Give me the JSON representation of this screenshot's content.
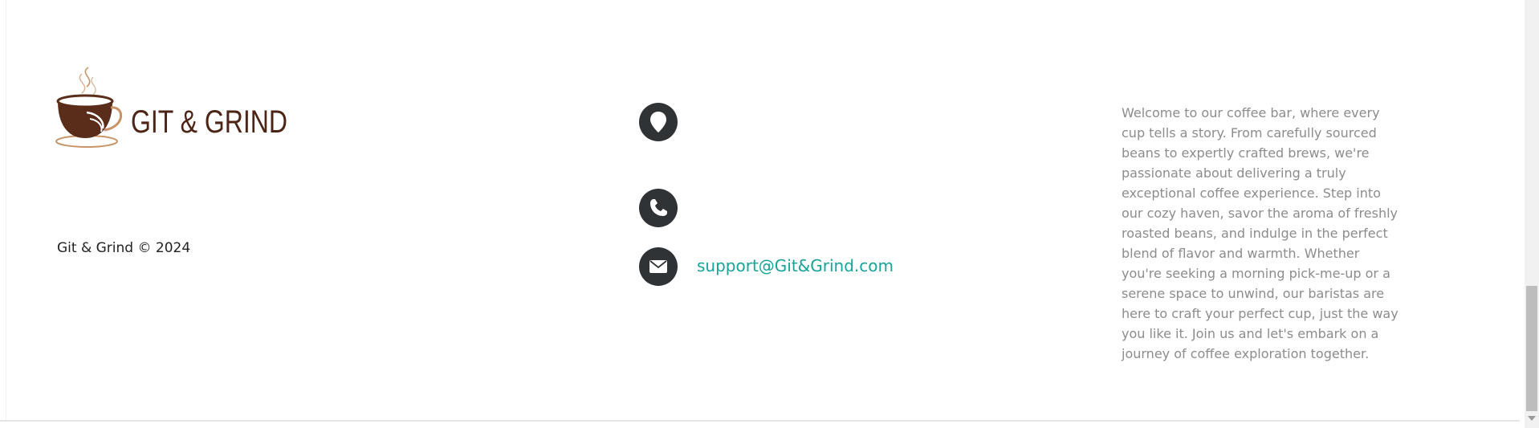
{
  "brand": {
    "logo_text": "GIT & GRIND",
    "logo_icon": "coffee-cup-icon",
    "colors": {
      "brand_brown": "#4d2516",
      "accent_tan": "#c89467"
    }
  },
  "footer": {
    "copyright": "Git & Grind © 2024",
    "contact": {
      "location_icon": "map-pin-icon",
      "phone_icon": "phone-icon",
      "email_icon": "envelope-icon",
      "email": "support@Git&Grind.com",
      "icon_bg_color": "#2f3335",
      "link_color": "#16a398"
    },
    "about": "Welcome to our coffee bar, where every cup tells a story. From carefully sourced beans to expertly crafted brews, we're passionate about delivering a truly exceptional coffee experience. Step into our cozy haven, savor the aroma of freshly roasted beans, and indulge in the perfect blend of flavor and warmth. Whether you're seeking a morning pick-me-up or a serene space to unwind, our baristas are here to craft your perfect cup, just the way you like it. Join us and let's embark on a journey of coffee exploration together."
  }
}
